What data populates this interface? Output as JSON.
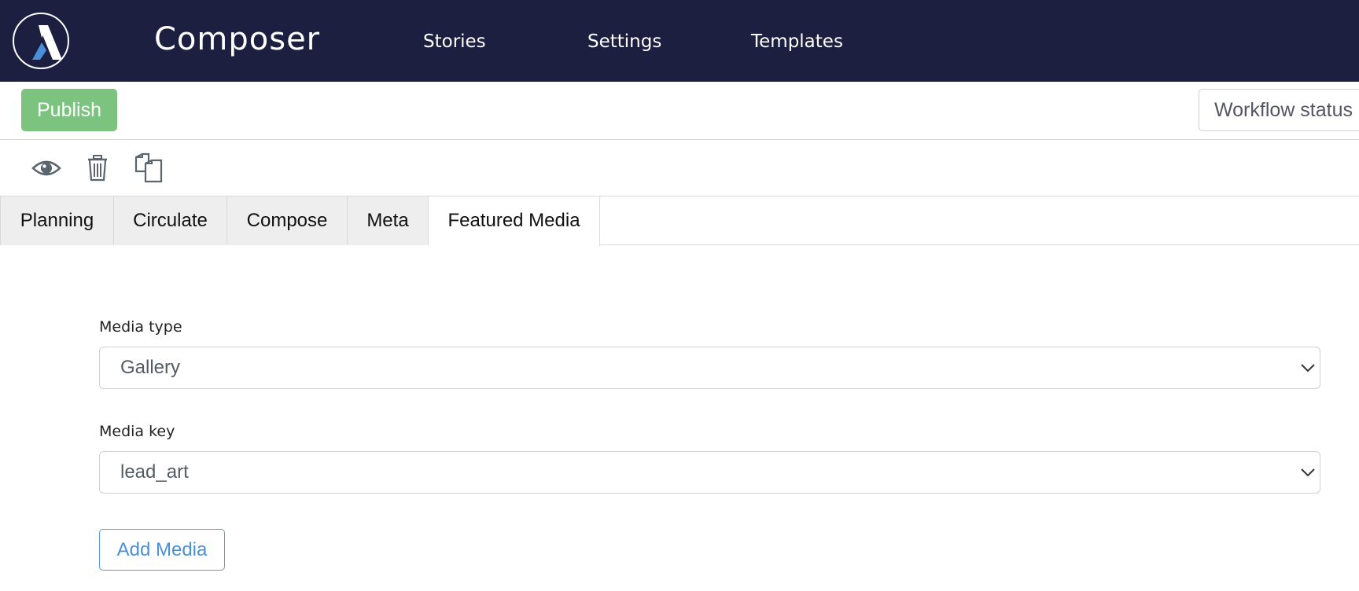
{
  "header": {
    "app_title": "Composer",
    "nav": [
      {
        "label": "Stories"
      },
      {
        "label": "Settings"
      },
      {
        "label": "Templates"
      }
    ]
  },
  "toolbar": {
    "publish_label": "Publish",
    "workflow_label": "Workflow status"
  },
  "icons": {
    "preview": "eye-icon",
    "delete": "trash-icon",
    "copy": "copy-icon"
  },
  "tabs": [
    {
      "label": "Planning",
      "active": false
    },
    {
      "label": "Circulate",
      "active": false
    },
    {
      "label": "Compose",
      "active": false
    },
    {
      "label": "Meta",
      "active": false
    },
    {
      "label": "Featured Media",
      "active": true
    }
  ],
  "form": {
    "media_type": {
      "label": "Media type",
      "value": "Gallery"
    },
    "media_key": {
      "label": "Media key",
      "value": "lead_art"
    },
    "add_media_label": "Add Media"
  },
  "colors": {
    "nav_background": "#1c1f40",
    "publish_green": "#7cc37f",
    "link_blue": "#4a90d9"
  }
}
